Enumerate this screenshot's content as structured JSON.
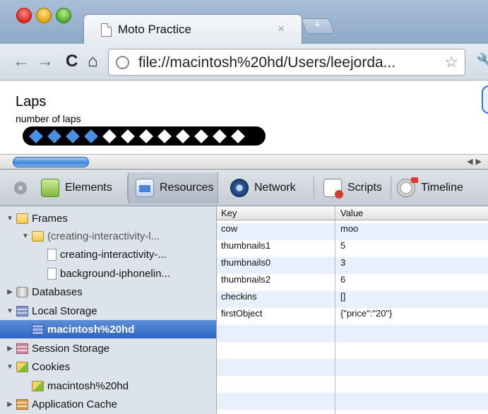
{
  "browser": {
    "tab_title": "Moto Practice",
    "tab_close": "×",
    "new_tab": "+",
    "url": "file://macintosh%20hd/Users/leejorda...",
    "nav": {
      "back": "←",
      "forward": "→",
      "reload": "C",
      "home": "⌂",
      "star": "☆",
      "wrench": "🔧"
    }
  },
  "page": {
    "title": "Laps",
    "subtitle": "number of laps",
    "laps_total": 12,
    "laps_selected": 4
  },
  "devtools": {
    "close": "×",
    "panels": [
      {
        "label": "Elements",
        "icon": "elements-icon"
      },
      {
        "label": "Resources",
        "icon": "resources-icon",
        "selected": true
      },
      {
        "label": "Network",
        "icon": "network-icon"
      },
      {
        "label": "Scripts",
        "icon": "scripts-icon"
      },
      {
        "label": "Timeline",
        "icon": "timeline-icon"
      }
    ],
    "tree": [
      {
        "label": "Frames",
        "level": 0,
        "arrow": "▼",
        "icon": "folder-icon"
      },
      {
        "label": "(creating-interactivity-l...",
        "level": 1,
        "arrow": "▼",
        "icon": "folder-icon",
        "muted": true
      },
      {
        "label": "creating-interactivity-...",
        "level": 2,
        "arrow": "",
        "icon": "doc-icon"
      },
      {
        "label": "background-iphonelin...",
        "level": 2,
        "arrow": "",
        "icon": "doc-icon"
      },
      {
        "label": "Databases",
        "level": 0,
        "arrow": "▶",
        "icon": "database-icon"
      },
      {
        "label": "Local Storage",
        "level": 0,
        "arrow": "▼",
        "icon": "local-storage-icon"
      },
      {
        "label": "macintosh%20hd",
        "level": 1,
        "arrow": "",
        "icon": "local-storage-icon",
        "selected": true
      },
      {
        "label": "Session Storage",
        "level": 0,
        "arrow": "▶",
        "icon": "session-storage-icon"
      },
      {
        "label": "Cookies",
        "level": 0,
        "arrow": "▼",
        "icon": "cookie-icon"
      },
      {
        "label": "macintosh%20hd",
        "level": 1,
        "arrow": "",
        "icon": "cookie-icon"
      },
      {
        "label": "Application Cache",
        "level": 0,
        "arrow": "▶",
        "icon": "app-cache-icon"
      }
    ],
    "grid": {
      "columns": [
        "Key",
        "Value"
      ],
      "rows": [
        {
          "key": "cow",
          "value": "moo"
        },
        {
          "key": "thumbnails1",
          "value": "5"
        },
        {
          "key": "thumbnails0",
          "value": "3"
        },
        {
          "key": "thumbnails2",
          "value": "6"
        },
        {
          "key": "checkins",
          "value": "[]"
        },
        {
          "key": "firstObject",
          "value": "{\"price\":\"20\"}"
        }
      ]
    }
  }
}
